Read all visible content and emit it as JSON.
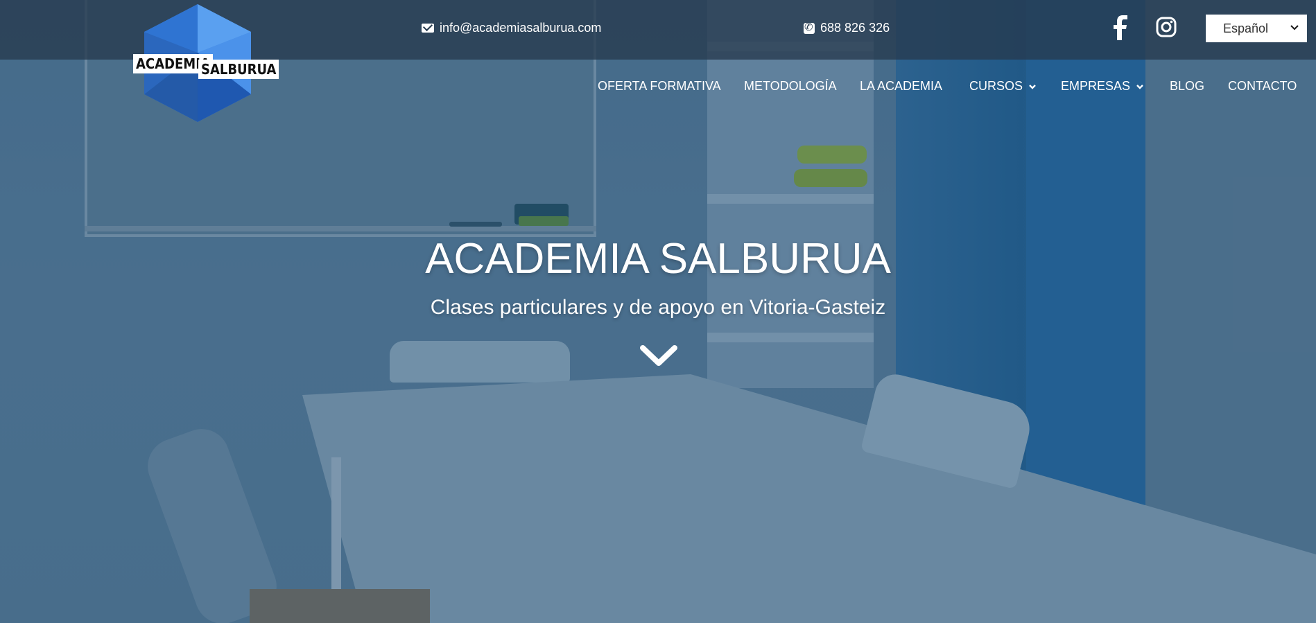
{
  "topbar": {
    "email": "info@academiasalburua.com",
    "phone": "688 826 326",
    "social": {
      "facebook_icon": "facebook-icon",
      "instagram_icon": "instagram-icon"
    },
    "language_select": {
      "selected": "Español"
    }
  },
  "logo": {
    "line1": "ACADEMIA",
    "line2": "SALBURUA"
  },
  "nav": {
    "items": [
      {
        "label": "OFERTA FORMATIVA",
        "dropdown": false
      },
      {
        "label": "METODOLOGÍA",
        "dropdown": false
      },
      {
        "label": "LA ACADEMIA",
        "dropdown": false
      },
      {
        "label": "CURSOS",
        "dropdown": true
      },
      {
        "label": "EMPRESAS",
        "dropdown": true
      },
      {
        "label": "BLOG",
        "dropdown": false
      },
      {
        "label": "CONTACTO",
        "dropdown": false
      }
    ]
  },
  "hero": {
    "title": "ACADEMIA SALBURUA",
    "subtitle": "Clases particulares y de apoyo en Vitoria-Gasteiz",
    "scroll_icon": "chevron-down-icon"
  },
  "colors": {
    "topbar_bg": "#263a4e",
    "overlay": "#285073",
    "logo_blue": "#2f7de0",
    "accent_wall": "#1e5f93"
  }
}
